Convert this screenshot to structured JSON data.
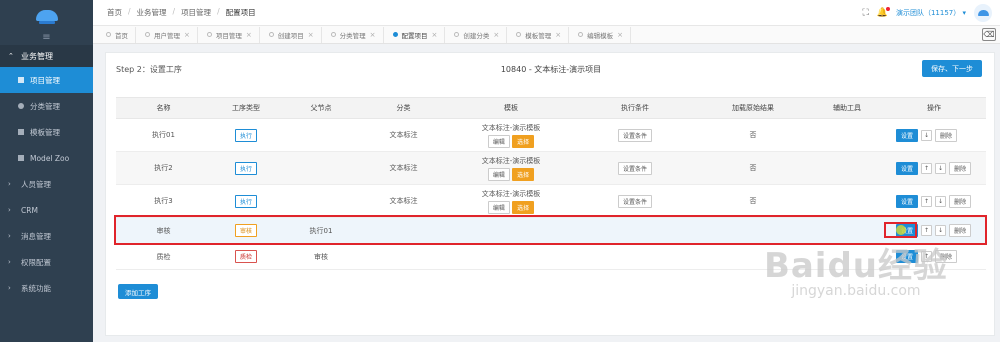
{
  "sidebar": {
    "collapse_icon": "hamburger-icon",
    "open_group": {
      "label": "业务管理",
      "chevron": "chevron-up-icon"
    },
    "items": [
      {
        "label": "项目管理",
        "icon": "square-icon",
        "active": true
      },
      {
        "label": "分类管理",
        "icon": "circle-icon",
        "active": false
      },
      {
        "label": "模板管理",
        "icon": "list-icon",
        "active": false
      },
      {
        "label": "Model Zoo",
        "icon": "file-icon",
        "active": false
      }
    ],
    "groups": [
      {
        "label": "人员管理"
      },
      {
        "label": "CRM"
      },
      {
        "label": "消息管理"
      },
      {
        "label": "权限配置"
      },
      {
        "label": "系统功能"
      }
    ]
  },
  "breadcrumb": [
    "首页",
    "业务管理",
    "项目管理",
    "配置项目"
  ],
  "topbar": {
    "user_label": "演示团队（11157）",
    "fullscreen_icon": "fullscreen-icon",
    "bell_icon": "bell-icon"
  },
  "tabs": [
    {
      "label": "首页",
      "active": false
    },
    {
      "label": "用户管理",
      "active": false
    },
    {
      "label": "项目管理",
      "active": false
    },
    {
      "label": "创建项目",
      "active": false
    },
    {
      "label": "分类管理",
      "active": false
    },
    {
      "label": "配置项目",
      "active": true
    },
    {
      "label": "创建分类",
      "active": false
    },
    {
      "label": "模板管理",
      "active": false
    },
    {
      "label": "编辑模板",
      "active": false
    }
  ],
  "main": {
    "step_title": "Step 2：设置工序",
    "project_title": "10840 - 文本标注-演示项目",
    "save_label": "保存、下一步",
    "add_label": "添加工序",
    "columns": [
      "名称",
      "工序类型",
      "父节点",
      "分类",
      "模板",
      "执行条件",
      "加载原始结果",
      "辅助工具",
      "操作"
    ],
    "rows": [
      {
        "name": "执行01",
        "type": "执行",
        "parent": "",
        "category": "文本标注",
        "template": "文本标注-演示模板",
        "tpl_edit": "编辑",
        "tpl_select": "选择",
        "condition": "设置条件",
        "load_result": "否",
        "ops": {
          "set": "设置",
          "up": "",
          "down": "↓",
          "delete": "删除"
        }
      },
      {
        "name": "执行2",
        "type": "执行",
        "parent": "",
        "category": "文本标注",
        "template": "文本标注-演示模板",
        "tpl_edit": "编辑",
        "tpl_select": "选择",
        "condition": "设置条件",
        "load_result": "否",
        "ops": {
          "set": "设置",
          "up": "↑",
          "down": "↓",
          "delete": "删除"
        }
      },
      {
        "name": "执行3",
        "type": "执行",
        "parent": "",
        "category": "文本标注",
        "template": "文本标注-演示模板",
        "tpl_edit": "编辑",
        "tpl_select": "选择",
        "condition": "设置条件",
        "load_result": "否",
        "ops": {
          "set": "设置",
          "up": "↑",
          "down": "↓",
          "delete": "删除"
        }
      },
      {
        "name": "审核",
        "type": "审核",
        "parent": "执行01",
        "category": "",
        "template": "",
        "condition": "",
        "load_result": "",
        "ops": {
          "set": "设置",
          "up": "↑",
          "down": "↓",
          "delete": "删除"
        }
      },
      {
        "name": "质检",
        "type": "质检",
        "parent": "审核",
        "category": "",
        "template": "",
        "condition": "",
        "load_result": "",
        "ops": {
          "set": "设置",
          "up": "↑",
          "down": "",
          "delete": "删除"
        }
      }
    ]
  },
  "watermark": {
    "logo": "Baidu经验",
    "url": "jingyan.baidu.com"
  }
}
